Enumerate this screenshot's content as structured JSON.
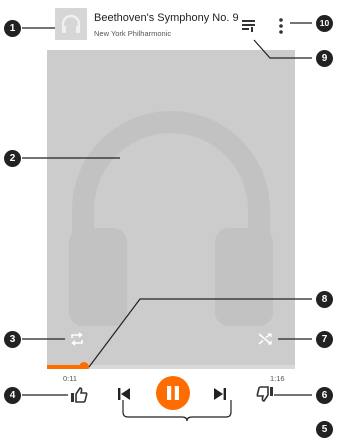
{
  "header": {
    "title": "Beethoven's Symphony No. 9",
    "subtitle": "New York Philharmonic"
  },
  "playback": {
    "elapsed": "0:11",
    "duration": "1:16",
    "progress_fraction": 0.15
  },
  "icons": {
    "thumbnail": "headphones-icon",
    "album_art": "headphones-icon",
    "queue": "queue-list-icon",
    "more": "more-vert-icon",
    "repeat": "repeat-icon",
    "shuffle": "shuffle-icon",
    "thumbs_up": "thumbs-up-icon",
    "thumbs_down": "thumbs-down-icon",
    "previous": "skip-previous-icon",
    "pause": "pause-icon",
    "next": "skip-next-icon"
  },
  "colors": {
    "accent": "#ff6d00",
    "callout": "#222222",
    "art_background": "#cccccc"
  },
  "callouts": [
    "1",
    "2",
    "3",
    "4",
    "5",
    "6",
    "7",
    "8",
    "9",
    "10"
  ]
}
